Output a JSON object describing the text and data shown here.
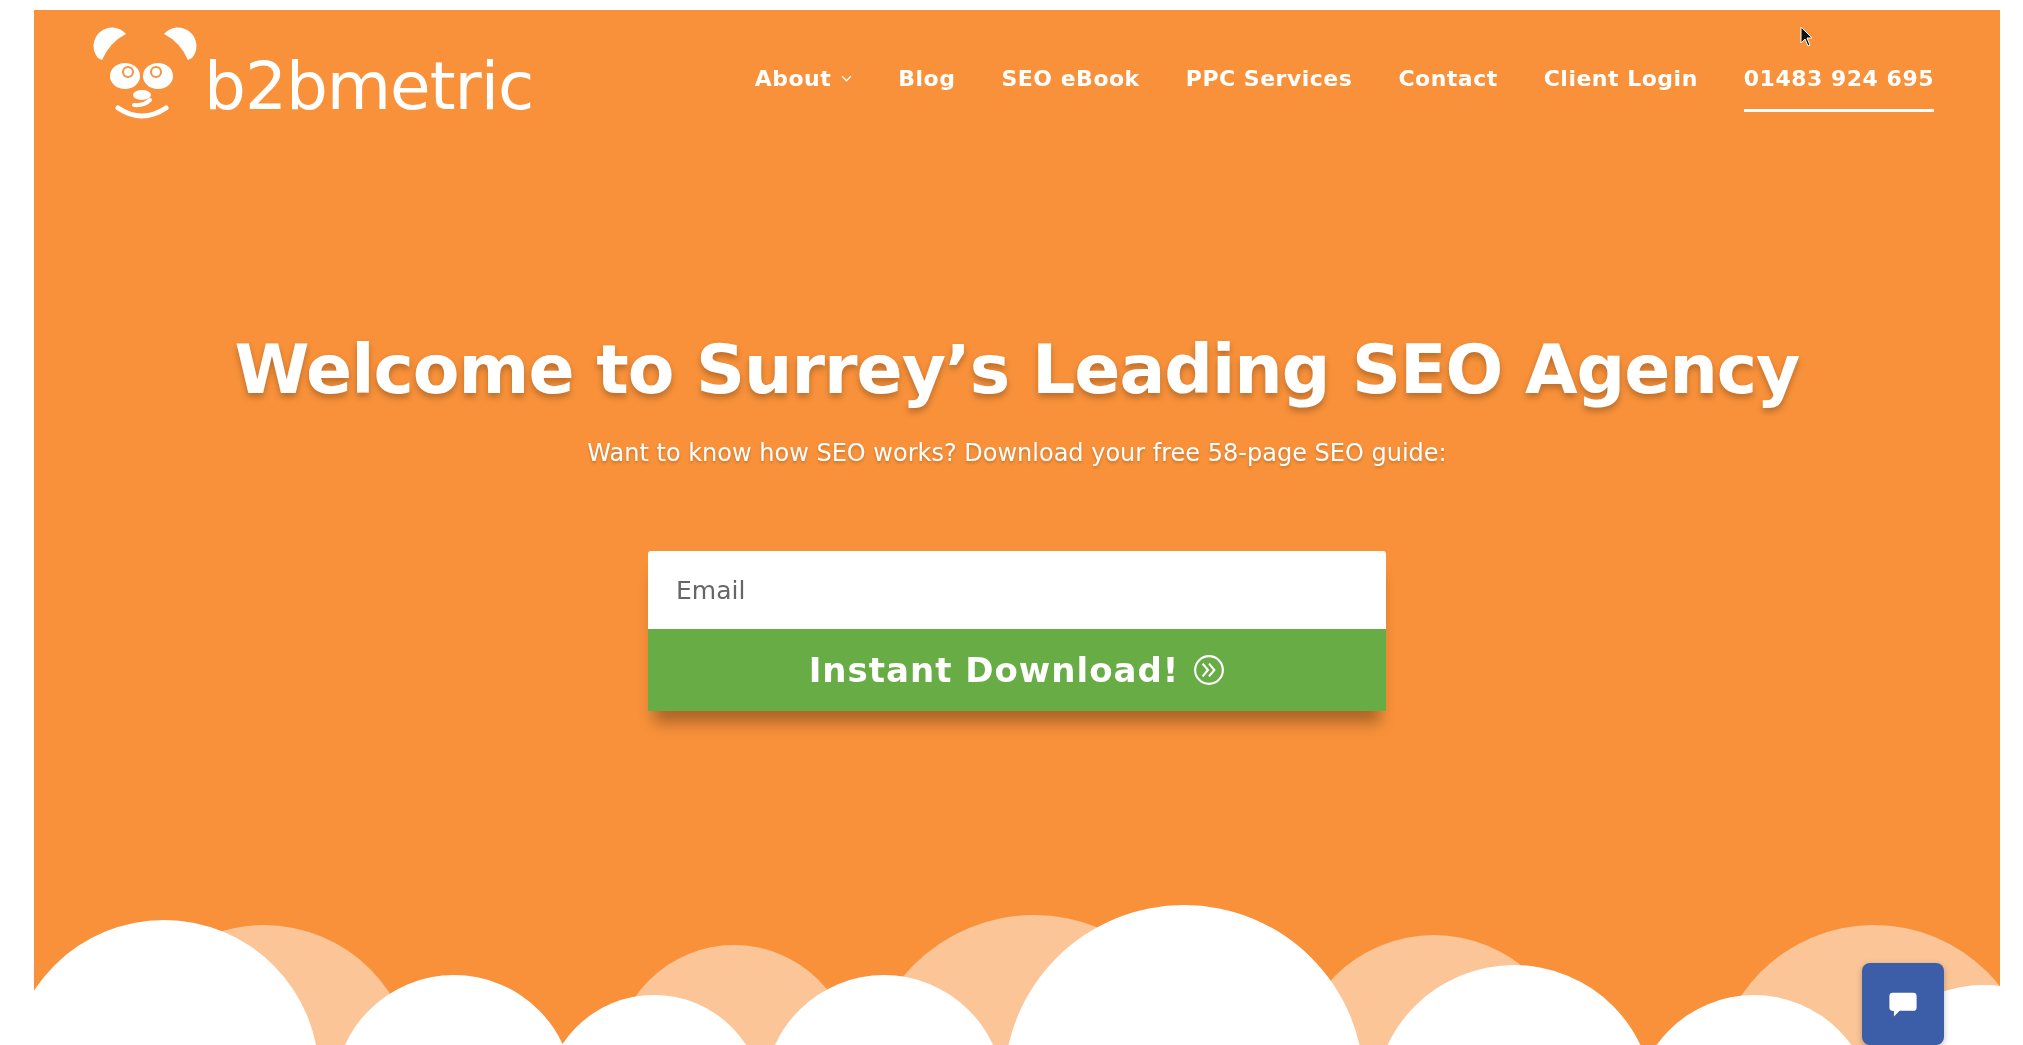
{
  "logo": {
    "text": "b2bmetric"
  },
  "nav": [
    {
      "label": "About",
      "dropdown": true,
      "selected": false
    },
    {
      "label": "Blog",
      "dropdown": false,
      "selected": false
    },
    {
      "label": "SEO eBook",
      "dropdown": false,
      "selected": false
    },
    {
      "label": "PPC Services",
      "dropdown": false,
      "selected": false
    },
    {
      "label": "Contact",
      "dropdown": false,
      "selected": false
    },
    {
      "label": "Client Login",
      "dropdown": false,
      "selected": false
    },
    {
      "label": "01483 924 695",
      "dropdown": false,
      "selected": true
    }
  ],
  "hero": {
    "title": "Welcome to Surrey’s Leading SEO Agency",
    "subtitle": "Want to know how SEO works? Download your free 58-page SEO guide:"
  },
  "form": {
    "email": {
      "placeholder": "Email"
    },
    "button": "Instant Download!"
  }
}
